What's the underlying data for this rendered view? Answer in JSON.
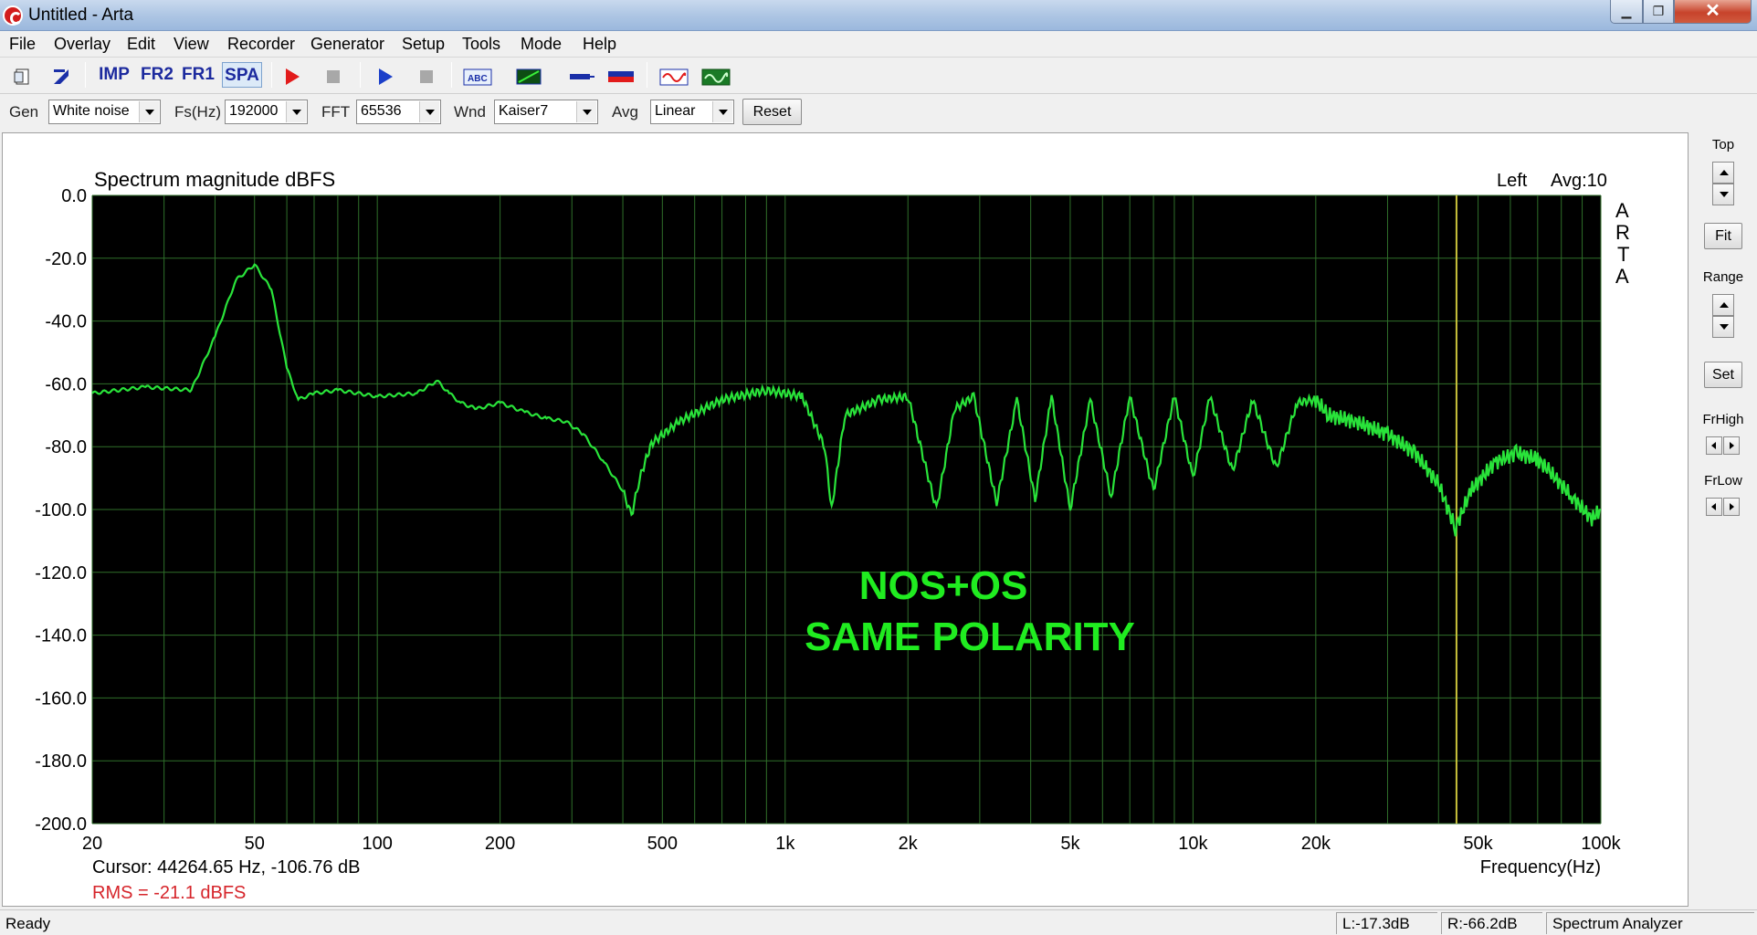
{
  "window": {
    "title": "Untitled - Arta",
    "minimize_glyph": "▁",
    "maximize_glyph": "❐",
    "close_glyph": "✕"
  },
  "menu": [
    "File",
    "Overlay",
    "Edit",
    "View",
    "Recorder",
    "Generator",
    "Setup",
    "Tools",
    "Mode",
    "Help"
  ],
  "toolbar": {
    "imp_label": "IMP",
    "fr2_label": "FR2",
    "fr1_label": "FR1",
    "spa_label": "SPA",
    "selected_mode": "SPA",
    "icons": [
      "new-document-icon",
      "open-icon",
      "record-icon",
      "stop-icon",
      "play-icon",
      "stop-icon",
      "text-abc-icon",
      "grid-icon",
      "probe-icon",
      "color-bar-icon",
      "sine-generator-icon",
      "oscilloscope-icon"
    ]
  },
  "settings": {
    "gen_label": "Gen",
    "gen_value": "White noise",
    "fs_label": "Fs(Hz)",
    "fs_value": "192000",
    "fft_label": "FFT",
    "fft_value": "65536",
    "wnd_label": "Wnd",
    "wnd_value": "Kaiser7",
    "avg_label": "Avg",
    "avg_value": "Linear",
    "reset_label": "Reset"
  },
  "graph": {
    "title": "Spectrum magnitude dBFS",
    "channel": "Left",
    "avg": "Avg:10",
    "watermark": [
      "A",
      "R",
      "T",
      "A"
    ],
    "annotation_line1": "NOS+OS",
    "annotation_line2": "SAME POLARITY",
    "x_axis_label": "Frequency(Hz)",
    "cursor_text": "Cursor: 44264.65 Hz, -106.76 dB",
    "rms_text": "RMS =  -21.1 dBFS",
    "colors": {
      "background": "#000000",
      "grid": "#2f6f2a",
      "trace": "#29e33a",
      "cursor": "#c9c23b",
      "annotation": "#20ec20",
      "rms": "#d6252b"
    }
  },
  "chart_data": {
    "type": "line",
    "title": "Spectrum magnitude dBFS",
    "xlabel": "Frequency(Hz)",
    "ylabel": "",
    "x_scale": "log",
    "xlim": [
      20,
      100000
    ],
    "ylim": [
      -200,
      0
    ],
    "x_ticks": [
      20,
      50,
      100,
      200,
      500,
      1000,
      2000,
      5000,
      10000,
      20000,
      50000,
      100000
    ],
    "x_tick_labels": [
      "20",
      "50",
      "100",
      "200",
      "500",
      "1k",
      "2k",
      "5k",
      "10k",
      "20k",
      "50k",
      "100k"
    ],
    "y_ticks": [
      0,
      -20,
      -40,
      -60,
      -80,
      -100,
      -120,
      -140,
      -160,
      -180,
      -200
    ],
    "y_tick_labels": [
      "0.0",
      "-20.0",
      "-40.0",
      "-60.0",
      "-80.0",
      "-100.0",
      "-120.0",
      "-140.0",
      "-160.0",
      "-180.0",
      "-200.0"
    ],
    "grid": true,
    "cursor_x": 44264.65,
    "series": [
      {
        "x": [
          20,
          27,
          35,
          40,
          45,
          50,
          55,
          60,
          64,
          70,
          80,
          100,
          125,
          140,
          150,
          160,
          175,
          200,
          230,
          260,
          290,
          320,
          360,
          400,
          420,
          440,
          470,
          550,
          700,
          900,
          1100,
          1250,
          1300,
          1400,
          1700,
          2000,
          2350,
          2600,
          2900,
          3300,
          3700,
          4100,
          4500,
          5000,
          5600,
          6300,
          7000,
          8000,
          9000,
          10000,
          11000,
          12500,
          14000,
          16000,
          18000,
          20000,
          21500,
          25000,
          30000,
          35000,
          40000,
          44000,
          48000,
          55000,
          62000,
          70000,
          75000,
          85000,
          95000,
          100000
        ],
        "values": [
          -63,
          -61,
          -62,
          -45,
          -27,
          -22,
          -30,
          -55,
          -65,
          -63,
          -62,
          -64,
          -63,
          -59,
          -63,
          -66,
          -68,
          -66,
          -69,
          -71,
          -72,
          -76,
          -85,
          -94,
          -102,
          -90,
          -79,
          -72,
          -65,
          -62,
          -64,
          -80,
          -100,
          -70,
          -65,
          -64,
          -100,
          -68,
          -64,
          -98,
          -65,
          -97,
          -64,
          -100,
          -65,
          -96,
          -64,
          -94,
          -64,
          -90,
          -64,
          -88,
          -65,
          -87,
          -66,
          -65,
          -70,
          -72,
          -76,
          -82,
          -92,
          -106,
          -94,
          -85,
          -82,
          -84,
          -88,
          -96,
          -103,
          -100
        ]
      }
    ]
  },
  "right_panel": {
    "top_label": "Top",
    "fit_label": "Fit",
    "range_label": "Range",
    "set_label": "Set",
    "frhigh_label": "FrHigh",
    "frlow_label": "FrLow"
  },
  "status": {
    "ready": "Ready",
    "left_level": "L:-17.3dB",
    "right_level": "R:-66.2dB",
    "mode": "Spectrum Analyzer"
  }
}
